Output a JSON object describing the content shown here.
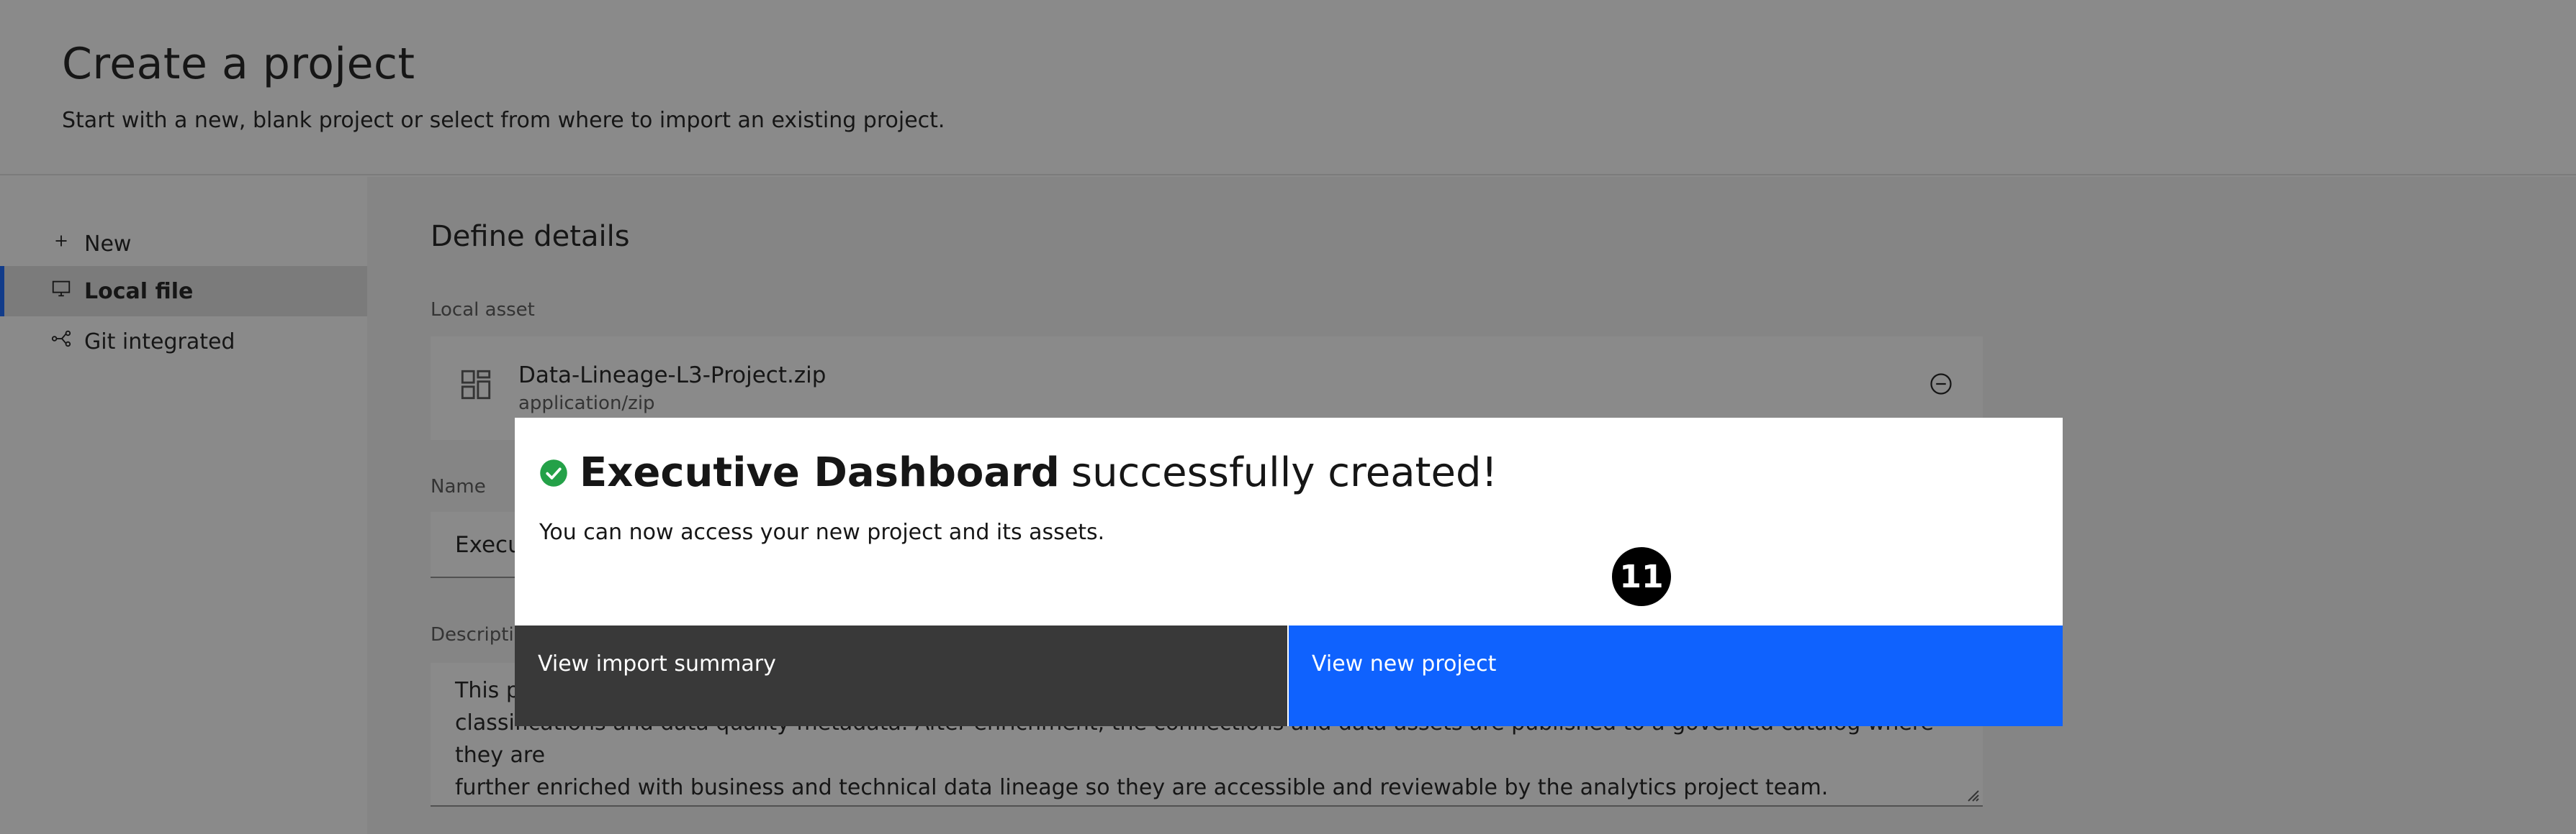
{
  "header": {
    "title": "Create a project",
    "subtitle": "Start with a new, blank project or select from where to import an existing project."
  },
  "sidebar": {
    "items": [
      {
        "label": "New",
        "icon": "add-icon",
        "selected": false
      },
      {
        "label": "Local file",
        "icon": "desktop-icon",
        "selected": true
      },
      {
        "label": "Git integrated",
        "icon": "git-branch-icon",
        "selected": false
      }
    ]
  },
  "main": {
    "section_title": "Define details",
    "local_asset": {
      "label": "Local asset",
      "file_name": "Data-Lineage-L3-Project.zip",
      "file_type": "application/zip"
    },
    "name": {
      "label": "Name",
      "value": "Execu"
    },
    "description": {
      "label": "Descriptio",
      "line1": "This p",
      "line2": "classifications and data quality metadata. After enrichment, the connections and data assets are published to a governed catalog where they are",
      "line3": "further enriched with business and technical data lineage so they are accessible and reviewable by the analytics project team."
    }
  },
  "modal": {
    "title_bold": "Executive Dashboard",
    "title_rest": "successfully created!",
    "body": "You can now access your new project and its assets.",
    "step_badge": "11",
    "secondary_button": "View import summary",
    "primary_button": "View new project"
  },
  "colors": {
    "accent": "#0f62fe",
    "success": "#24a148",
    "secondary_button": "#393939",
    "overlay": "rgba(22,22,22,0.5)"
  }
}
